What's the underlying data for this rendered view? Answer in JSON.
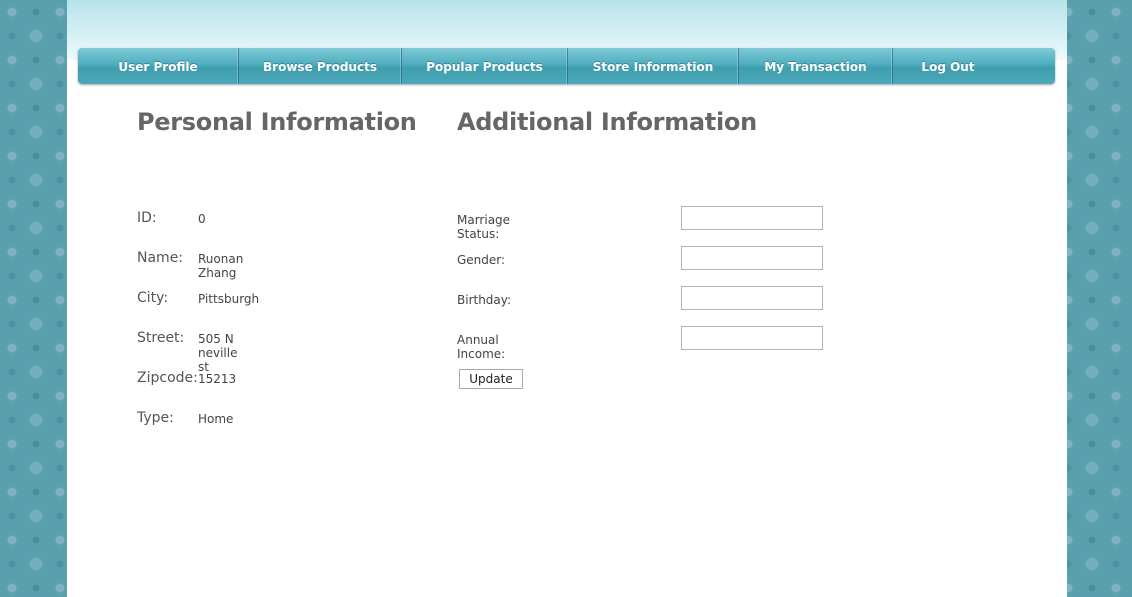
{
  "nav": {
    "items": [
      {
        "label": "User Profile"
      },
      {
        "label": "Browse Products"
      },
      {
        "label": "Popular Products"
      },
      {
        "label": "Store Information"
      },
      {
        "label": "My Transaction"
      },
      {
        "label": "Log Out"
      }
    ]
  },
  "personal": {
    "title": "Personal Information",
    "fields": [
      {
        "label": "ID:",
        "value": "0"
      },
      {
        "label": "Name:",
        "value": "Ruonan Zhang"
      },
      {
        "label": "City:",
        "value": "Pittsburgh"
      },
      {
        "label": "Street:",
        "value": "505 N neville st"
      },
      {
        "label": "Zipcode:",
        "value": "15213"
      },
      {
        "label": "Type:",
        "value": "Home"
      }
    ]
  },
  "additional": {
    "title": "Additional Information",
    "fields": [
      {
        "label": "Marriage Status:",
        "value": ""
      },
      {
        "label": "Gender:",
        "value": ""
      },
      {
        "label": "Birthday:",
        "value": ""
      },
      {
        "label": "Annual Income:",
        "value": ""
      }
    ],
    "update_label": "Update"
  },
  "colors": {
    "background_pattern": "#5a9fae",
    "nav_bar": "#4eaebf",
    "heading_text": "#666666"
  }
}
